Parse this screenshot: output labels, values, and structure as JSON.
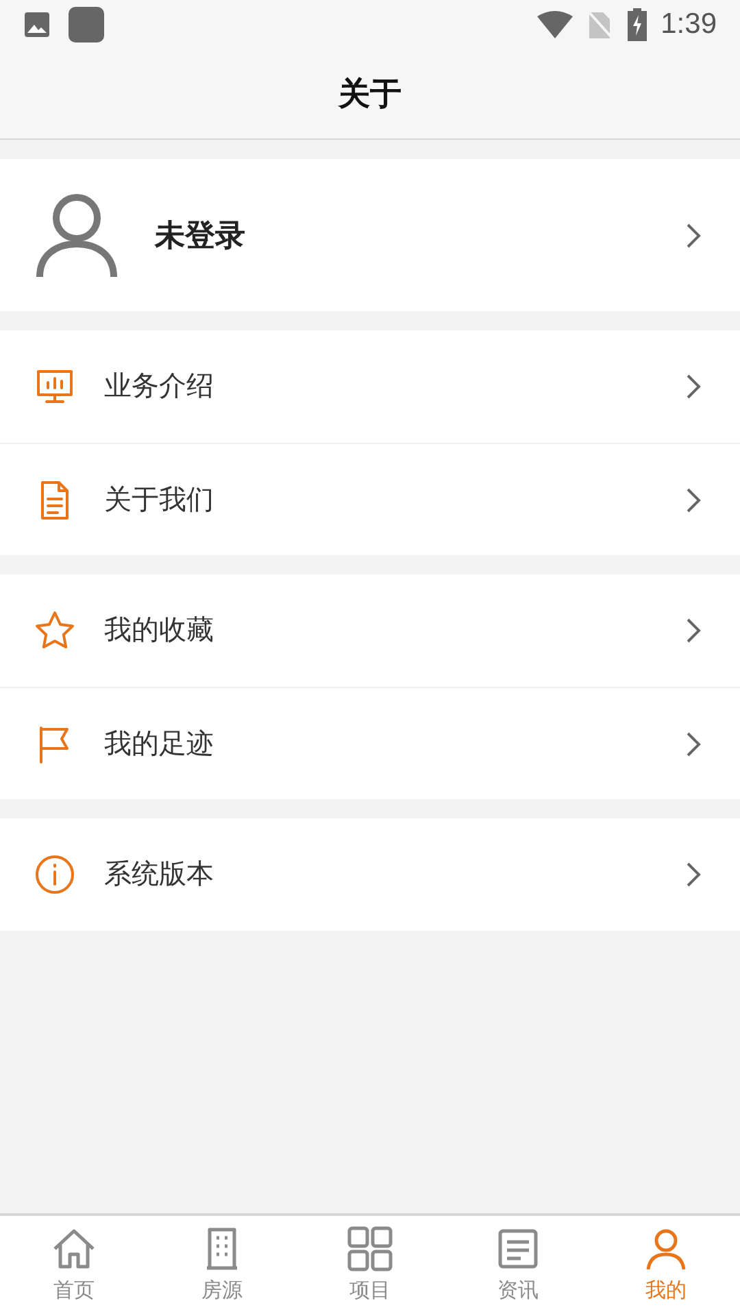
{
  "status_bar": {
    "time": "1:39"
  },
  "title": "关于",
  "profile": {
    "name": "未登录"
  },
  "groups": [
    [
      {
        "kind": "monitor",
        "label": "业务介绍"
      },
      {
        "kind": "document",
        "label": "关于我们"
      }
    ],
    [
      {
        "kind": "star",
        "label": "我的收藏"
      },
      {
        "kind": "flag",
        "label": "我的足迹"
      }
    ],
    [
      {
        "kind": "info",
        "label": "系统版本"
      }
    ]
  ],
  "tabs": [
    {
      "kind": "home",
      "label": "首页",
      "selected": false
    },
    {
      "kind": "building",
      "label": "房源",
      "selected": false
    },
    {
      "kind": "grid",
      "label": "项目",
      "selected": false
    },
    {
      "kind": "news",
      "label": "资讯",
      "selected": false
    },
    {
      "kind": "user",
      "label": "我的",
      "selected": true
    }
  ]
}
